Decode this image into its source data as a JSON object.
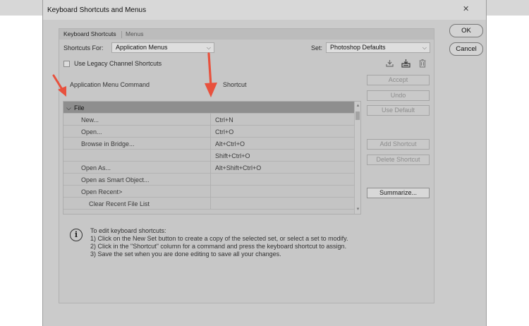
{
  "window": {
    "title": "Keyboard Shortcuts and Menus",
    "close_glyph": "✕"
  },
  "tabs": [
    {
      "label": "Keyboard Shortcuts",
      "active": true
    },
    {
      "label": "Menus",
      "active": false
    }
  ],
  "controls": {
    "shortcuts_for_label": "Shortcuts For:",
    "shortcuts_for_value": "Application Menus",
    "set_label": "Set:",
    "set_value": "Photoshop Defaults",
    "legacy_checkbox_label": "Use Legacy Channel Shortcuts",
    "legacy_checked": false
  },
  "columns": {
    "command": "Application Menu Command",
    "shortcut": "Shortcut"
  },
  "rows": [
    {
      "command": "File",
      "shortcut": "",
      "type": "group"
    },
    {
      "command": "New...",
      "shortcut": "Ctrl+N"
    },
    {
      "command": "Open...",
      "shortcut": "Ctrl+O"
    },
    {
      "command": "Browse in Bridge...",
      "shortcut": "Alt+Ctrl+O"
    },
    {
      "command": "",
      "shortcut": "Shift+Ctrl+O"
    },
    {
      "command": "Open As...",
      "shortcut": "Alt+Shift+Ctrl+O"
    },
    {
      "command": "Open as Smart Object...",
      "shortcut": ""
    },
    {
      "command": "Open Recent>",
      "shortcut": ""
    },
    {
      "command": "Clear Recent File List",
      "shortcut": "",
      "indent": 2
    }
  ],
  "side_buttons": {
    "accept": "Accept",
    "undo": "Undo",
    "use_default": "Use Default",
    "add_shortcut": "Add Shortcut",
    "delete_shortcut": "Delete Shortcut",
    "summarize": "Summarize..."
  },
  "instructions": [
    "To edit keyboard shortcuts:",
    "1) Click on the New Set button to create a copy of the selected set, or select a set to modify.",
    "2) Click in the \"Shortcut\" column for a command and press the keyboard shortcut to assign.",
    "3) Save the set when you are done editing to save all your changes."
  ],
  "dialog_buttons": {
    "ok": "OK",
    "cancel": "Cancel"
  },
  "icons": {
    "save_set": "save-set-icon",
    "new_set": "new-set-icon",
    "delete_set": "trash-icon",
    "info": "info-icon",
    "caret": "chevron-down-icon"
  },
  "colors": {
    "annotation_arrow": "#e8513d",
    "group_row": "#8e8e8e"
  }
}
